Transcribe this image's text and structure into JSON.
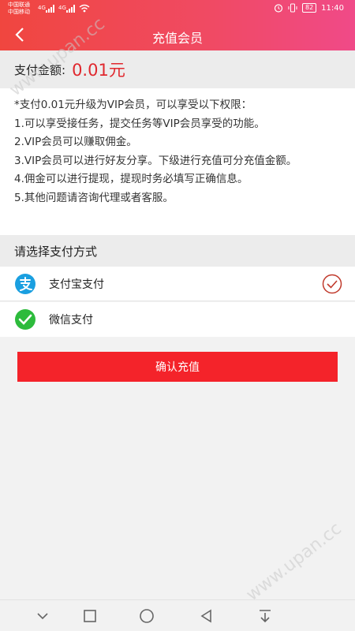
{
  "status_bar": {
    "carrier_1": "中国联通",
    "carrier_2": "中国移动",
    "signal_1": "4G",
    "signal_2": "4G",
    "battery": "82",
    "time": "11:40"
  },
  "nav": {
    "title": "充值会员"
  },
  "amount": {
    "label": "支付金额:",
    "value": "0.01元"
  },
  "description": {
    "lines": [
      "*支付0.01元升级为VIP会员，可以享受以下权限：",
      "1.可以享受接任务，提交任务等VIP会员享受的功能。",
      "2.VIP会员可以赚取佣金。",
      "3.VIP会员可以进行好友分享。下级进行充值可分充值金额。",
      "4.佣金可以进行提现，提现时务必填写正确信息。",
      "5.其他问题请咨询代理或者客服。"
    ]
  },
  "payment": {
    "header": "请选择支付方式",
    "methods": [
      {
        "label": "支付宝支付",
        "icon": "alipay-icon",
        "color": "#1a9fe0",
        "selected": true
      },
      {
        "label": "微信支付",
        "icon": "wechat-icon",
        "color": "#2dbb3c",
        "selected": false
      }
    ]
  },
  "confirm_button": "确认充值",
  "watermarks": [
    "www.upan.cc",
    "www.upan.cc"
  ],
  "colors": {
    "accent": "#f4232a",
    "amount": "#e0282e",
    "check": "#c0392b"
  }
}
